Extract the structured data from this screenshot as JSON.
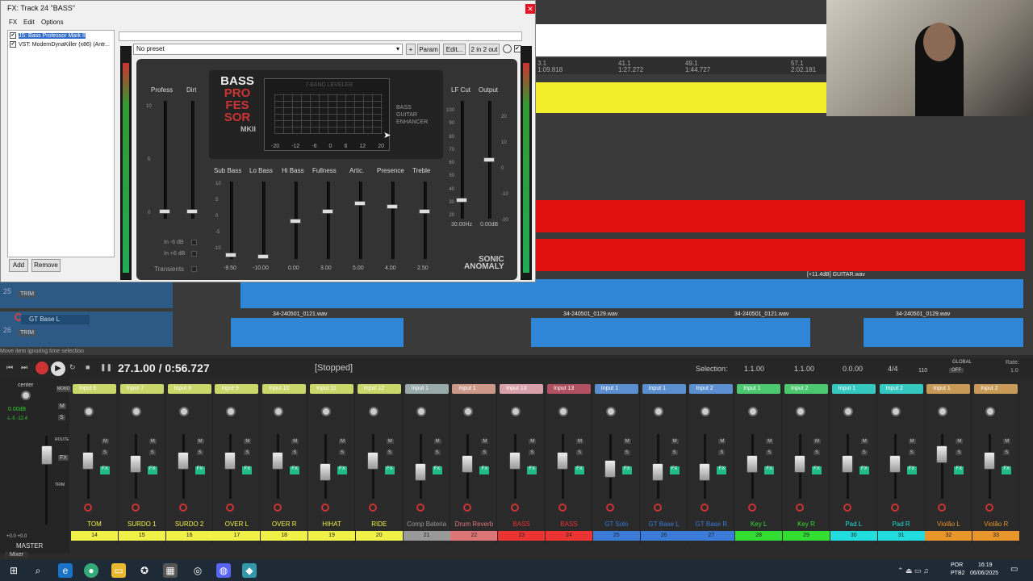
{
  "fx_window": {
    "title": "FX: Track 24 \"BASS\"",
    "menu": [
      "FX",
      "Edit",
      "Options"
    ],
    "fx_chain": [
      {
        "label": "JS: Bass Professor Mark II",
        "checked": true,
        "selected": true
      },
      {
        "label": "VST: ModernDynaKiller (x86) (Antr...",
        "checked": true,
        "selected": false
      }
    ],
    "add_label": "Add",
    "remove_label": "Remove",
    "preset": "No preset",
    "plus_label": "+",
    "param_label": "Param",
    "edit_label": "Edit...",
    "io_label": "2 in 2 out"
  },
  "plugin": {
    "logo_lines": [
      "BASS",
      "PRO",
      "FES",
      "SOR"
    ],
    "logo_sub": "MKII",
    "eq_title": "7-BAND LEVELER",
    "eq_scale": [
      "-20",
      "-12",
      "-6",
      "0",
      "6",
      "12",
      "20"
    ],
    "enhancer_lines": [
      "BASS",
      "GUITAR",
      "ENHANCER"
    ],
    "labels_top": {
      "profess": "Profess",
      "dirt": "Dirt",
      "lf_cut": "LF Cut",
      "output": "Output"
    },
    "profess_ticks": [
      "10",
      "5",
      "0"
    ],
    "lfcut_ticks": [
      "100",
      "90",
      "80",
      "70",
      "60",
      "50",
      "40",
      "30",
      "20"
    ],
    "output_ticks": [
      "20",
      "10",
      "0",
      "-10",
      "-20"
    ],
    "band_ticks": [
      "10",
      "5",
      "0",
      "-5",
      "-10"
    ],
    "lf_cut_value": "30.00Hz",
    "output_value": "0.00dB",
    "options": [
      "In -6 dB",
      "In +6 dB",
      "Transients"
    ],
    "bands": [
      {
        "label": "Sub Bass",
        "value": "-9.50"
      },
      {
        "label": "Lo Bass",
        "value": "-10.00"
      },
      {
        "label": "Hi Bass",
        "value": "0.00"
      },
      {
        "label": "Fullness",
        "value": "3.00"
      },
      {
        "label": "Artic.",
        "value": "5.00"
      },
      {
        "label": "Presence",
        "value": "4.00"
      },
      {
        "label": "Treble",
        "value": "2.50"
      }
    ],
    "brand_lines": [
      "SONIC",
      "ANOMALY"
    ]
  },
  "arrange": {
    "ruler": [
      {
        "bar": "3.1",
        "time": "1:09.818"
      },
      {
        "bar": "41.1",
        "time": "1:27.272"
      },
      {
        "bar": "49.1",
        "time": "1:44.727"
      },
      {
        "bar": "57.1",
        "time": "2:02.181"
      }
    ],
    "clip_labels": [
      "34-240501_0121.wav",
      "34-240501_0129.wav",
      "34-240501_0121.wav",
      "34-240501_0129.wav"
    ],
    "guitar_clip": "[+11.4dB] GUITAR.wav",
    "tracks": [
      {
        "num": "25",
        "name": "",
        "trim": "TRIM"
      },
      {
        "num": "26",
        "name": "GT Base L",
        "trim": "TRIM"
      }
    ],
    "status": "Move item ignoring time selection"
  },
  "transport": {
    "position": "27.1.00 / 0:56.727",
    "state": "[Stopped]",
    "selection_label": "Selection:",
    "sel_start": "1.1.00",
    "sel_end": "1.1.00",
    "sel_len": "0.0.00",
    "time_sig": "4/4",
    "bpm": "110",
    "global": "GLOBAL",
    "global_state": "OFF",
    "rate_label": "Rate:",
    "rate_value": "1.0"
  },
  "master": {
    "label": "MASTER",
    "center": "center",
    "volume": "0.00dB",
    "peaks": "-L-5  -12.4",
    "io": "+0.0  +0.0",
    "buttons": [
      "MONO",
      "M",
      "S",
      "ROUTE",
      "FX",
      "TRIM"
    ]
  },
  "mixer_tab": "Mixer",
  "mixer_strips": [
    {
      "input": "Input 6",
      "name": "TOM",
      "num": "14",
      "color": "#c8d86a",
      "numcolor": "#f1f14a"
    },
    {
      "input": "Input 7",
      "name": "SURDO 1",
      "num": "15",
      "color": "#c8d86a",
      "numcolor": "#f1f14a"
    },
    {
      "input": "Input 8",
      "name": "SURDO 2",
      "num": "16",
      "color": "#c8d86a",
      "numcolor": "#f1f14a"
    },
    {
      "input": "Input 9",
      "name": "OVER L",
      "num": "17",
      "color": "#c8d86a",
      "numcolor": "#f1f14a"
    },
    {
      "input": "Input 10",
      "name": "OVER R",
      "num": "18",
      "color": "#c8d86a",
      "numcolor": "#f1f14a"
    },
    {
      "input": "Input 11",
      "name": "HIHAT",
      "num": "19",
      "color": "#c8d86a",
      "numcolor": "#f1f14a"
    },
    {
      "input": "Input 12",
      "name": "RIDE",
      "num": "20",
      "color": "#c8d86a",
      "numcolor": "#f1f14a"
    },
    {
      "input": "Input 1",
      "name": "Comp Bateria",
      "num": "21",
      "color": "#9aa",
      "numcolor": "#999"
    },
    {
      "input": "Input 1",
      "name": "Drum Reverb",
      "num": "22",
      "color": "#c98",
      "numcolor": "#d77"
    },
    {
      "input": "Input 13",
      "name": "BASS",
      "num": "23",
      "color": "#d8a0a8",
      "numcolor": "#e33"
    },
    {
      "input": "Input 13",
      "name": "BASS",
      "num": "24",
      "color": "#b05060",
      "numcolor": "#e33"
    },
    {
      "input": "Input 1",
      "name": "GT Solo",
      "num": "25",
      "color": "#5b8fd0",
      "numcolor": "#3b7bd8"
    },
    {
      "input": "Input 1",
      "name": "GT Base L",
      "num": "26",
      "color": "#5b8fd0",
      "numcolor": "#3b7bd8"
    },
    {
      "input": "Input 2",
      "name": "GT Base R",
      "num": "27",
      "color": "#5b8fd0",
      "numcolor": "#3b7bd8"
    },
    {
      "input": "Input 1",
      "name": "Key L",
      "num": "28",
      "color": "#4cc870",
      "numcolor": "#3d3"
    },
    {
      "input": "Input 2",
      "name": "Key R",
      "num": "29",
      "color": "#4cc870",
      "numcolor": "#3d3"
    },
    {
      "input": "Input 1",
      "name": "Pad L",
      "num": "30",
      "color": "#35c8c0",
      "numcolor": "#2dd"
    },
    {
      "input": "Input 2",
      "name": "Pad R",
      "num": "31",
      "color": "#35c8c0",
      "numcolor": "#2dd"
    },
    {
      "input": "Input 1",
      "name": "Violão L",
      "num": "32",
      "color": "#c89a58",
      "numcolor": "#e8952b"
    },
    {
      "input": "Input 2",
      "name": "Violão R",
      "num": "33",
      "color": "#c89a58",
      "numcolor": "#e8952b"
    }
  ],
  "taskbar": {
    "lang": "POR",
    "layout": "PTB2",
    "time": "16:19",
    "date": "06/06/2025"
  }
}
